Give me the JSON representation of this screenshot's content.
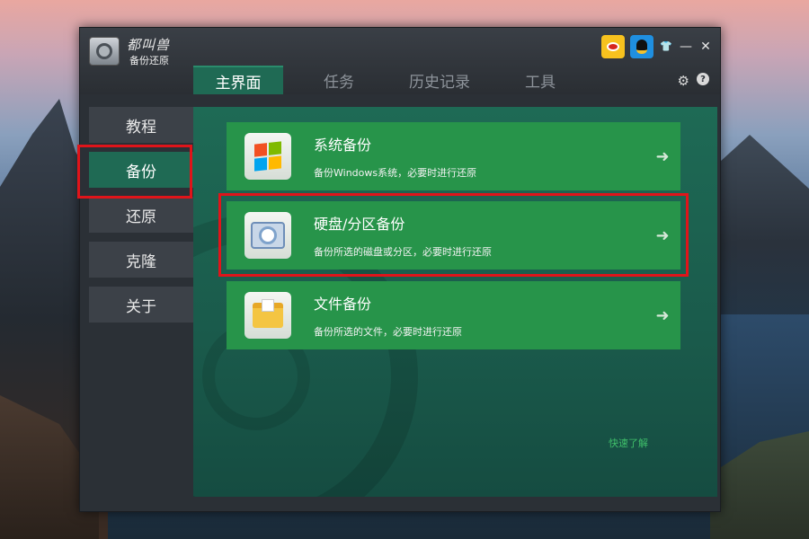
{
  "app": {
    "title_brand": "都叫兽",
    "title_product": "备份还原"
  },
  "tabs": [
    {
      "label": "主界面",
      "active": true
    },
    {
      "label": "任务",
      "active": false
    },
    {
      "label": "历史记录",
      "active": false
    },
    {
      "label": "工具",
      "active": false
    }
  ],
  "sidebar": {
    "items": [
      {
        "label": "教程",
        "active": false
      },
      {
        "label": "备份",
        "active": true
      },
      {
        "label": "还原",
        "active": false
      },
      {
        "label": "克隆",
        "active": false
      },
      {
        "label": "关于",
        "active": false
      }
    ]
  },
  "cards": [
    {
      "title": "系统备份",
      "desc": "备份Windows系统，必要时进行还原",
      "icon": "windows-logo-icon"
    },
    {
      "title": "硬盘/分区备份",
      "desc": "备份所选的磁盘或分区，必要时进行还原",
      "icon": "hard-disk-icon"
    },
    {
      "title": "文件备份",
      "desc": "备份所选的文件，必要时进行还原",
      "icon": "folder-icon"
    }
  ],
  "quick_link": "快速了解",
  "colors": {
    "accent_green": "#27944a",
    "highlight_red": "#e0141a",
    "panel_green": "#1e6a55"
  },
  "icons": {
    "arrow": "➜",
    "gear": "⚙",
    "help": "?",
    "minimize": "—",
    "close": "✕",
    "skin": "👕"
  }
}
